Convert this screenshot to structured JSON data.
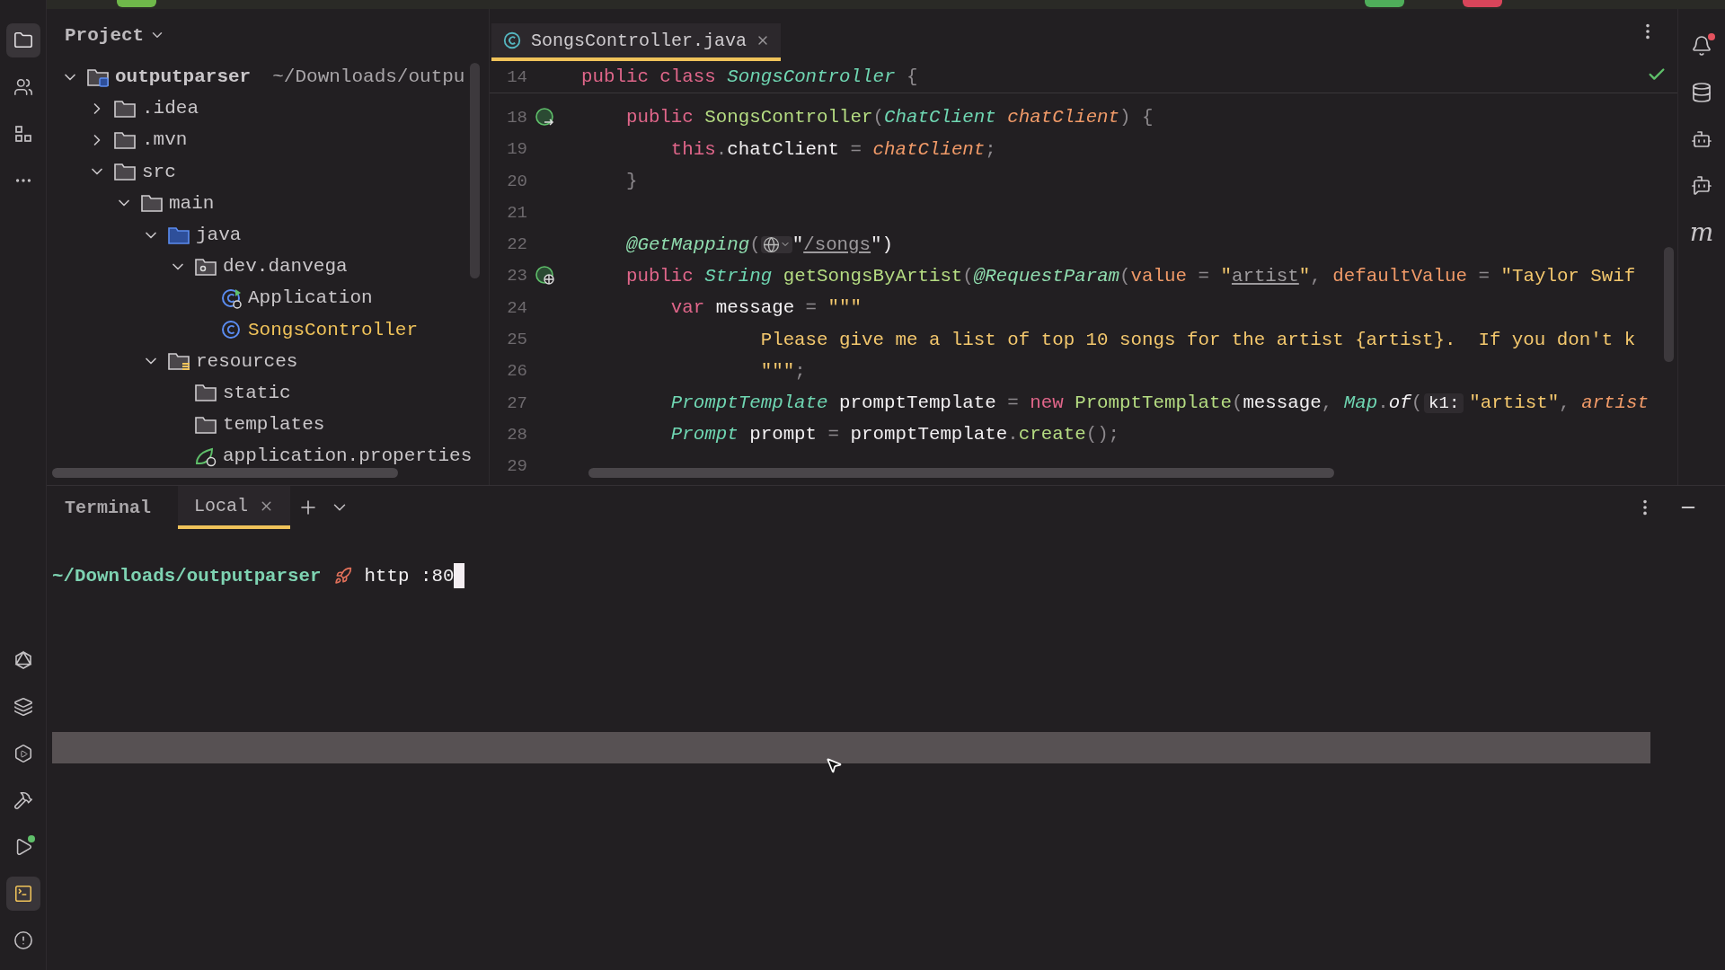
{
  "left_toolbar": {
    "top": [
      {
        "kind": "project",
        "selected": true
      },
      {
        "kind": "people",
        "selected": false
      },
      {
        "kind": "structure",
        "selected": false
      },
      {
        "kind": "more",
        "selected": false
      }
    ],
    "bottom": [
      {
        "kind": "graph",
        "selected": false
      },
      {
        "kind": "layers",
        "selected": false
      },
      {
        "kind": "services",
        "selected": false
      },
      {
        "kind": "build",
        "selected": false
      },
      {
        "kind": "run",
        "selected": false
      },
      {
        "kind": "terminal",
        "selected": true
      },
      {
        "kind": "problems",
        "selected": false
      }
    ]
  },
  "project": {
    "title": "Project",
    "tree": [
      {
        "label": "outputparser",
        "path": "~/Downloads/outpu",
        "kind": "module",
        "expanded": true,
        "children": [
          {
            "label": ".idea",
            "kind": "folder",
            "expanded": false
          },
          {
            "label": ".mvn",
            "kind": "folder",
            "expanded": false
          },
          {
            "label": "src",
            "kind": "folder",
            "expanded": true,
            "children": [
              {
                "label": "main",
                "kind": "folder",
                "expanded": true,
                "children": [
                  {
                    "label": "java",
                    "kind": "source-folder",
                    "expanded": true,
                    "children": [
                      {
                        "label": "dev.danvega",
                        "kind": "package",
                        "expanded": true,
                        "children": [
                          {
                            "label": "Application",
                            "kind": "spring-class",
                            "highlighted": false
                          },
                          {
                            "label": "SongsController",
                            "kind": "class",
                            "highlighted": true
                          }
                        ]
                      }
                    ]
                  },
                  {
                    "label": "resources",
                    "kind": "resource-folder",
                    "expanded": true,
                    "children": [
                      {
                        "label": "static",
                        "kind": "folder"
                      },
                      {
                        "label": "templates",
                        "kind": "folder"
                      },
                      {
                        "label": "application.properties",
                        "kind": "spring-file"
                      }
                    ]
                  }
                ]
              }
            ]
          }
        ]
      }
    ]
  },
  "editor": {
    "tabs": [
      {
        "label": "SongsController.java",
        "selected": true
      }
    ],
    "sticky_line": {
      "number": "14",
      "tokens": [
        {
          "text": "public class ",
          "kind": "kw"
        },
        {
          "text": "SongsController",
          "kind": "type"
        },
        {
          "text": " {",
          "kind": "punct"
        }
      ]
    },
    "lines": [
      {
        "number": "18",
        "marker": {
          "kind": "bean"
        },
        "tokens": [
          {
            "text": "    public ",
            "kind": "kw"
          },
          {
            "text": "SongsController",
            "kind": "fn"
          },
          {
            "text": "(",
            "kind": "punct"
          },
          {
            "text": "ChatClient ",
            "kind": "type"
          },
          {
            "text": "chatClient",
            "kind": "param"
          },
          {
            "text": ") {",
            "kind": "punct"
          }
        ]
      },
      {
        "number": "19",
        "tokens": [
          {
            "text": "        this",
            "kind": "kw"
          },
          {
            "text": ".",
            "kind": "punct"
          },
          {
            "text": "chatClient",
            "kind": "plain"
          },
          {
            "text": " = ",
            "kind": "punct"
          },
          {
            "text": "chatClient",
            "kind": "param"
          },
          {
            "text": ";",
            "kind": "punct"
          }
        ]
      },
      {
        "number": "20",
        "tokens": [
          {
            "text": "    }",
            "kind": "punct"
          }
        ]
      },
      {
        "number": "21"
      },
      {
        "number": "22",
        "tokens": [
          {
            "text": "    @GetMapping",
            "kind": "ann"
          },
          {
            "text": "(",
            "kind": "punct"
          },
          {
            "kind": "globe"
          },
          {
            "text": "\"",
            "kind": "plain"
          },
          {
            "text": "/songs",
            "kind": "url"
          },
          {
            "text": "\")",
            "kind": "plain"
          }
        ]
      },
      {
        "number": "23",
        "marker": {
          "kind": "web"
        },
        "tokens": [
          {
            "text": "    public ",
            "kind": "kw"
          },
          {
            "text": "String ",
            "kind": "type"
          },
          {
            "text": "getSongsByArtist",
            "kind": "fn"
          },
          {
            "text": "(",
            "kind": "punct"
          },
          {
            "text": "@RequestParam",
            "kind": "ann"
          },
          {
            "text": "(",
            "kind": "punct"
          },
          {
            "text": "value",
            "kind": "attr"
          },
          {
            "text": " = ",
            "kind": "punct"
          },
          {
            "text": "\"",
            "kind": "str"
          },
          {
            "text": "artist",
            "kind": "url"
          },
          {
            "text": "\"",
            "kind": "str"
          },
          {
            "text": ", ",
            "kind": "punct"
          },
          {
            "text": "defaultValue",
            "kind": "attr"
          },
          {
            "text": " = ",
            "kind": "punct"
          },
          {
            "text": "\"Taylor Swif",
            "kind": "str"
          }
        ]
      },
      {
        "number": "24",
        "tokens": [
          {
            "text": "        var ",
            "kind": "kw"
          },
          {
            "text": "message",
            "kind": "plain"
          },
          {
            "text": " = ",
            "kind": "punct"
          },
          {
            "text": "\"\"\"",
            "kind": "str"
          }
        ]
      },
      {
        "number": "25",
        "tokens": [
          {
            "text": "                Please give me a list of top 10 songs for the artist {artist}.  If you don't k",
            "kind": "str"
          }
        ]
      },
      {
        "number": "26",
        "tokens": [
          {
            "text": "                \"\"\"",
            "kind": "str"
          },
          {
            "text": ";",
            "kind": "punct"
          }
        ]
      },
      {
        "number": "27",
        "tokens": [
          {
            "text": "        PromptTemplate ",
            "kind": "type"
          },
          {
            "text": "promptTemplate",
            "kind": "plain"
          },
          {
            "text": " = ",
            "kind": "punct"
          },
          {
            "text": "new ",
            "kind": "kw"
          },
          {
            "text": "PromptTemplate",
            "kind": "fn"
          },
          {
            "text": "(",
            "kind": "punct"
          },
          {
            "text": "message",
            "kind": "plain"
          },
          {
            "text": ", ",
            "kind": "punct"
          },
          {
            "text": "Map",
            "kind": "type"
          },
          {
            "text": ".",
            "kind": "punct"
          },
          {
            "text": "of",
            "kind": "static"
          },
          {
            "text": "(",
            "kind": "punct"
          },
          {
            "text": "k1:",
            "kind": "hint"
          },
          {
            "text": "\"artist\"",
            "kind": "str"
          },
          {
            "text": ", ",
            "kind": "punct"
          },
          {
            "text": "artist",
            "kind": "param"
          }
        ]
      },
      {
        "number": "28",
        "tokens": [
          {
            "text": "        Prompt ",
            "kind": "type"
          },
          {
            "text": "prompt",
            "kind": "plain"
          },
          {
            "text": " = ",
            "kind": "punct"
          },
          {
            "text": "promptTemplate",
            "kind": "plain"
          },
          {
            "text": ".",
            "kind": "punct"
          },
          {
            "text": "create",
            "kind": "fn"
          },
          {
            "text": "();",
            "kind": "punct"
          }
        ]
      },
      {
        "number": "29"
      }
    ]
  },
  "right_toolbar": [
    {
      "kind": "notifications",
      "unread": true
    },
    {
      "kind": "database",
      "unread": false
    },
    {
      "kind": "assistant",
      "unread": false
    },
    {
      "kind": "chat",
      "unread": false
    },
    {
      "kind": "maven",
      "glyph": "m",
      "unread": false
    }
  ],
  "terminal": {
    "title": "Terminal",
    "tabs": [
      {
        "label": "Local",
        "selected": true
      }
    ],
    "prompt_path": "~/Downloads/outputparser",
    "command": "http :80"
  }
}
